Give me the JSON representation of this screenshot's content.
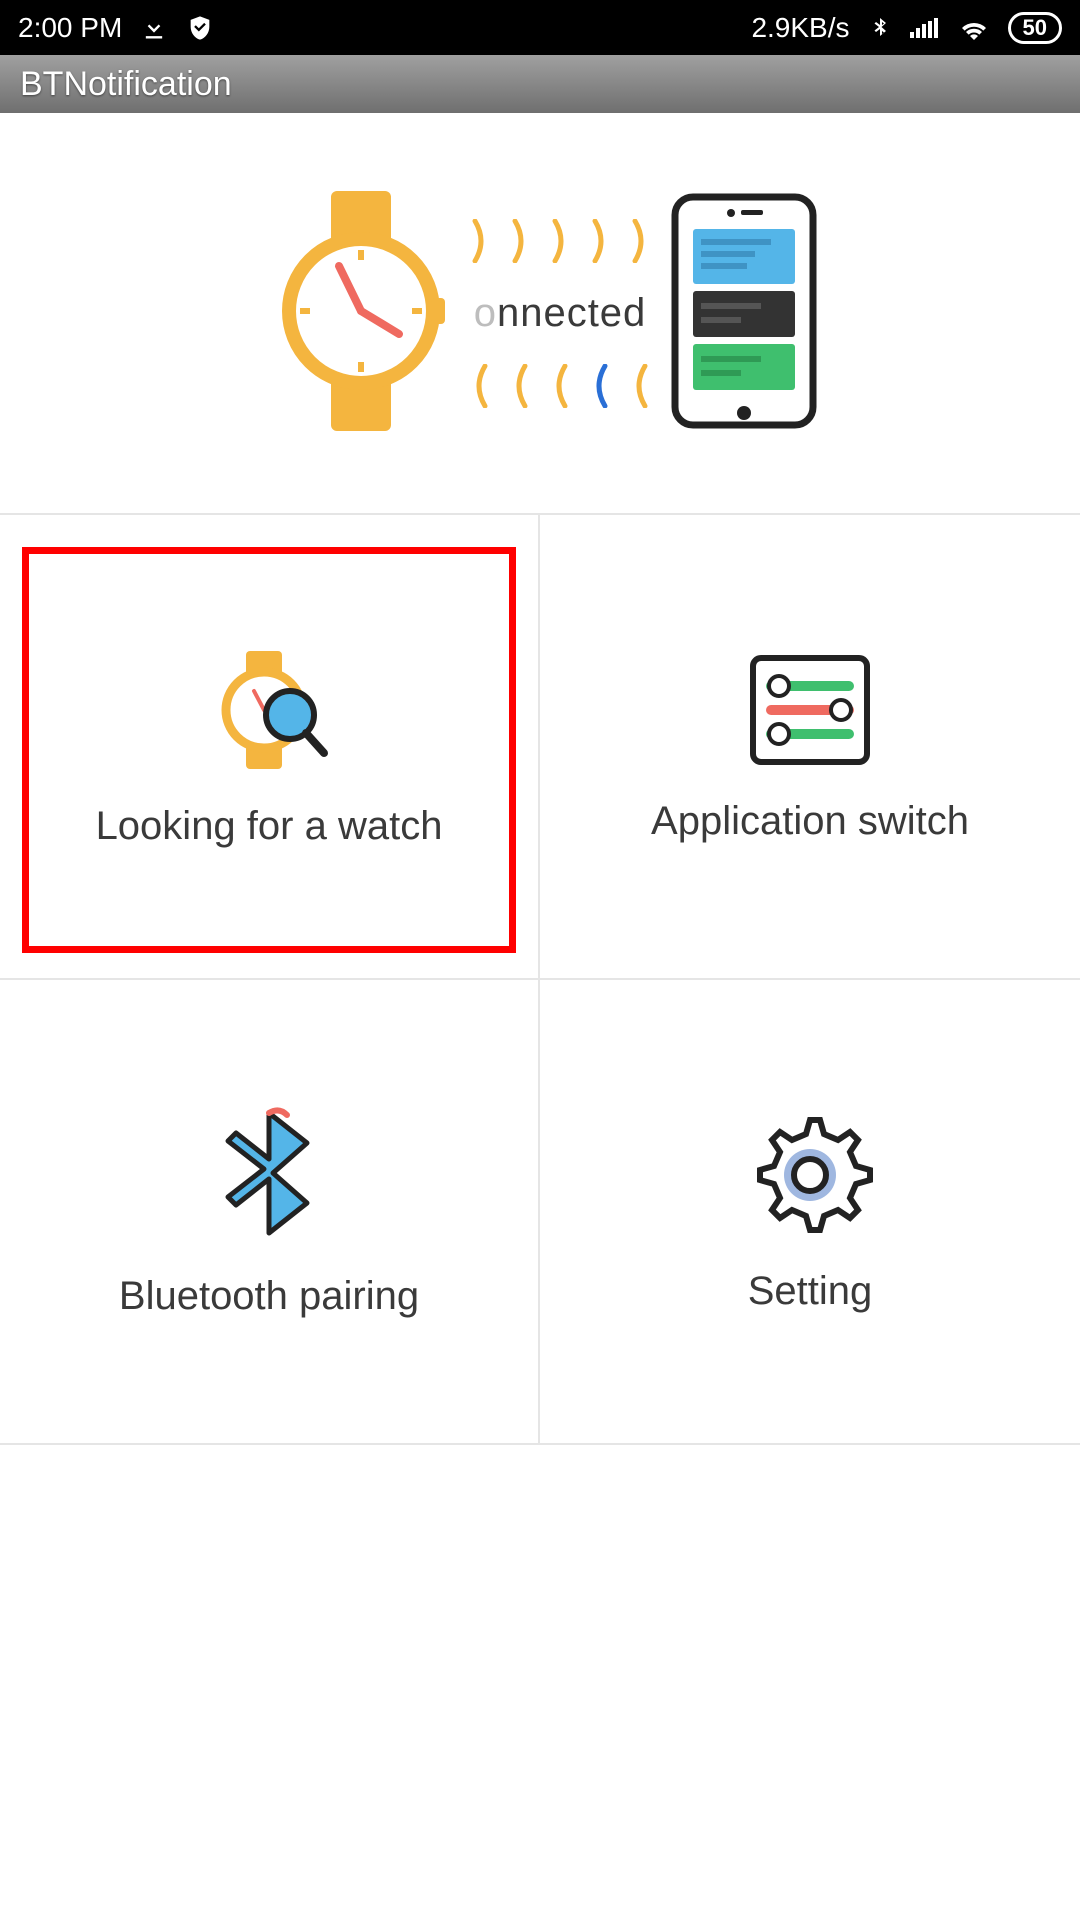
{
  "statusbar": {
    "time": "2:00 PM",
    "speed": "2.9KB/s",
    "battery": "50"
  },
  "titlebar": {
    "title": "BTNotification"
  },
  "hero": {
    "status_text": "onnected"
  },
  "grid": {
    "looking": "Looking for a watch",
    "appswitch": "Application switch",
    "btpair": "Bluetooth pairing",
    "setting": "Setting"
  }
}
